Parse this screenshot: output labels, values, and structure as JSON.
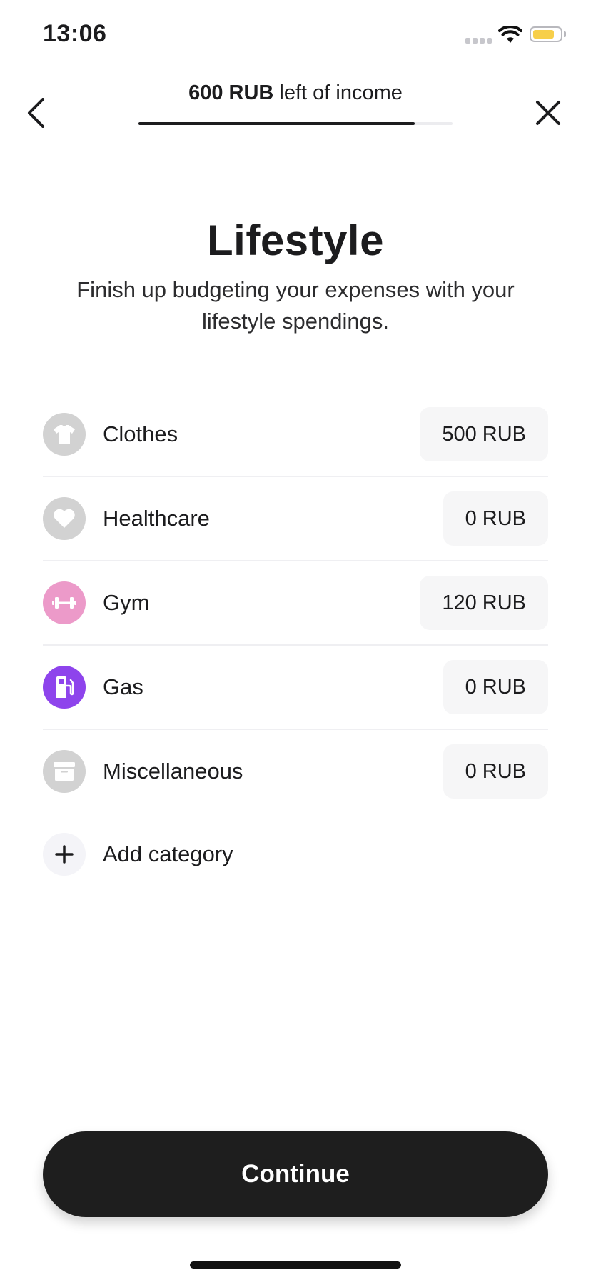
{
  "status_bar": {
    "time": "13:06"
  },
  "header": {
    "remaining_amount": "600 RUB",
    "remaining_suffix": " left of income",
    "progress_fraction": 0.88
  },
  "page": {
    "title": "Lifestyle",
    "subtitle": "Finish up budgeting your expenses with your lifestyle spendings."
  },
  "categories": [
    {
      "label": "Clothes",
      "amount": "500 RUB",
      "icon": "shirt-icon",
      "icon_bg": "#d2d2d2"
    },
    {
      "label": "Healthcare",
      "amount": "0 RUB",
      "icon": "heart-icon",
      "icon_bg": "#d2d2d2"
    },
    {
      "label": "Gym",
      "amount": "120 RUB",
      "icon": "dumbbell-icon",
      "icon_bg": "#ec9ac9"
    },
    {
      "label": "Gas",
      "amount": "0 RUB",
      "icon": "fuel-pump-icon",
      "icon_bg": "#8e44ec"
    },
    {
      "label": "Miscellaneous",
      "amount": "0 RUB",
      "icon": "archive-box-icon",
      "icon_bg": "#d2d2d2"
    }
  ],
  "add_category": {
    "label": "Add category",
    "icon": "plus-icon"
  },
  "footer": {
    "continue_label": "Continue"
  },
  "colors": {
    "accent_dark": "#1e1e1e",
    "amount_bg": "#f6f6f7",
    "divider": "#efeff2"
  }
}
